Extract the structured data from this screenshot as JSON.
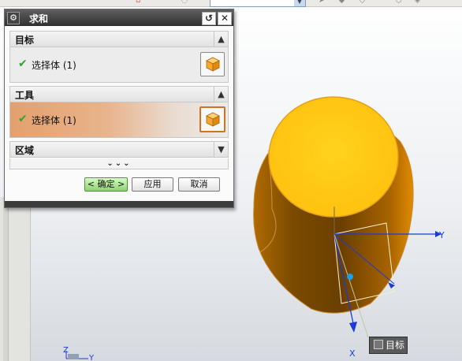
{
  "dialog": {
    "title": "求和",
    "sections": [
      {
        "header": "目标",
        "chevron": "up",
        "row_text": "选择体 (1)",
        "active": false
      },
      {
        "header": "工具",
        "chevron": "up",
        "row_text": "选择体 (1)",
        "active": true
      },
      {
        "header": "区域",
        "chevron": "down"
      }
    ],
    "more_label": "⌄⌄⌄",
    "buttons": {
      "ok": "< 确定 >",
      "apply": "应用",
      "cancel": "取消"
    }
  },
  "viewport": {
    "tooltip": "目标",
    "axis_labels": {
      "x": "X",
      "y": "Y",
      "z": "Z",
      "corner_y": "Y"
    },
    "colors": {
      "top_face": "#ffcc1a",
      "body_dark": "#7a4a00",
      "body_mid": "#c97a00",
      "axis": "#1a3bd6",
      "ok_green": "#8fd36f"
    }
  },
  "icons": [
    "gear-icon",
    "reset-icon",
    "close-icon",
    "check-icon",
    "cube-select-icon",
    "chevron-up-icon",
    "chevron-down-icon"
  ]
}
